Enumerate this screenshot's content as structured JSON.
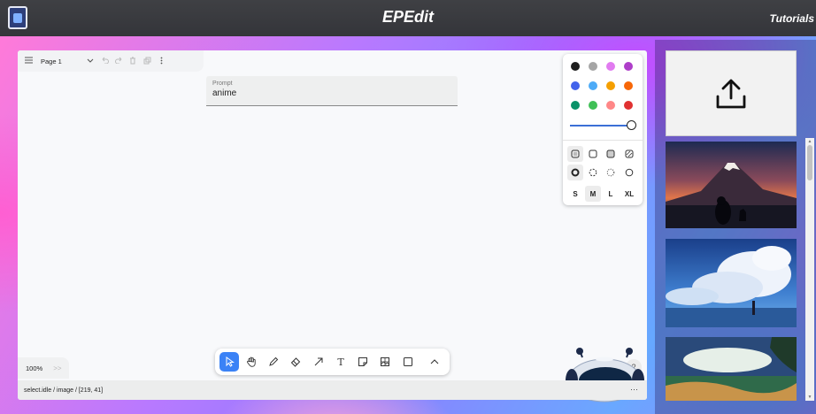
{
  "app": {
    "title": "EPEdit",
    "tutorials_link": "Tutorials"
  },
  "page_menu": {
    "page_label": "Page 1"
  },
  "prompt": {
    "label": "Prompt",
    "value": "anime"
  },
  "style_panel": {
    "colors": [
      "#1e1e1e",
      "#a5a5a5",
      "#e17bf0",
      "#ae3ec9",
      "#4263eb",
      "#4dabf7",
      "#f59f00",
      "#f76707",
      "#099268",
      "#40c057",
      "#ff8787",
      "#e03131"
    ],
    "opacity_percent": 100,
    "sizes": [
      "S",
      "M",
      "L",
      "XL"
    ],
    "selected_size": "M"
  },
  "zoom": {
    "level": "100%",
    "expand": ">>"
  },
  "status": {
    "text": "select.idle / image / [219, 41]",
    "more": "···"
  },
  "help": {
    "label": "?"
  },
  "toolbar": {
    "tools": [
      "select",
      "hand",
      "draw",
      "eraser",
      "arrow",
      "text",
      "note",
      "asset",
      "rectangle",
      "more"
    ],
    "active": "select",
    "text_tool_glyph": "T"
  }
}
